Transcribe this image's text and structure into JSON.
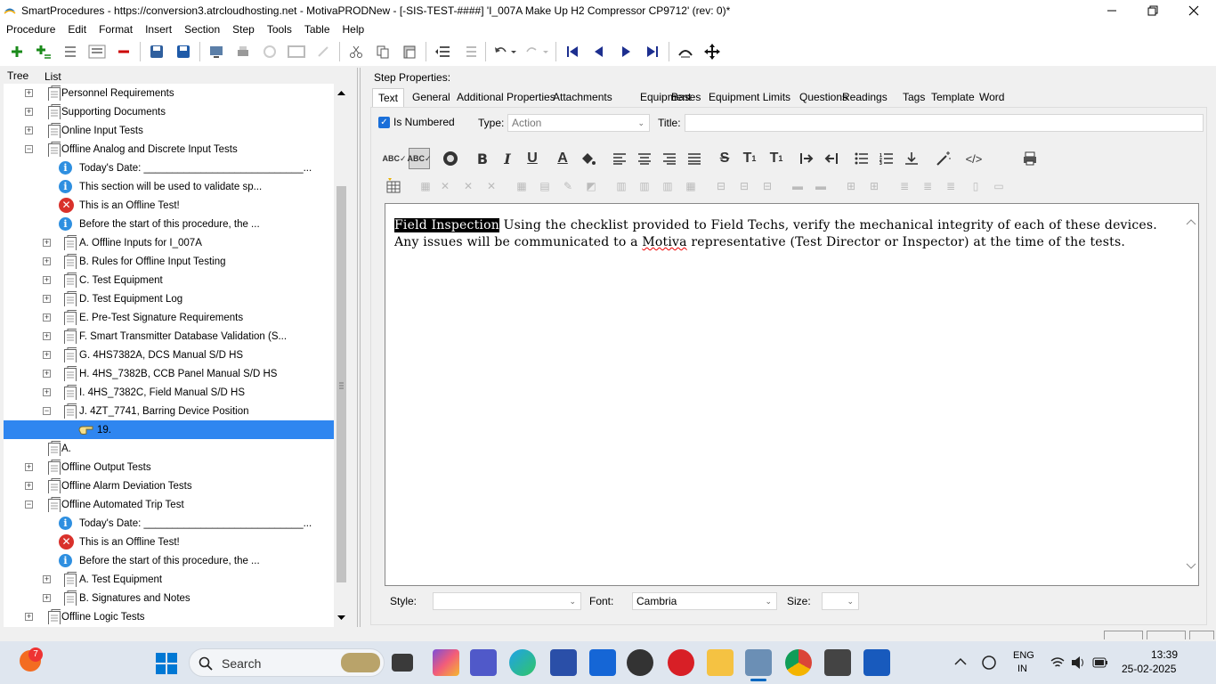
{
  "window": {
    "title": "SmartProcedures - https://conversion3.atrcloudhosting.net - MotivaPRODNew - [-SIS-TEST-####] 'I_007A Make Up H2 Compressor CP9712' (rev: 0)*"
  },
  "menu": [
    "Procedure",
    "Edit",
    "Format",
    "Insert",
    "Section",
    "Step",
    "Tools",
    "Table",
    "Help"
  ],
  "left_tabs": {
    "tree": "Tree",
    "list": "List"
  },
  "tree": [
    {
      "indent": 1,
      "expand": "+",
      "icon": "doc",
      "label": "Personnel Requirements"
    },
    {
      "indent": 1,
      "expand": "+",
      "icon": "doc",
      "label": "Supporting Documents"
    },
    {
      "indent": 1,
      "expand": "+",
      "icon": "doc",
      "label": "Online Input Tests"
    },
    {
      "indent": 1,
      "expand": "−",
      "icon": "doc",
      "label": "Offline Analog and Discrete Input Tests"
    },
    {
      "indent": 2,
      "expand": "",
      "icon": "info",
      "label": "Today's Date: ____________________________..."
    },
    {
      "indent": 2,
      "expand": "",
      "icon": "info",
      "label": "This section will be used to validate sp..."
    },
    {
      "indent": 2,
      "expand": "",
      "icon": "x",
      "label": "This is an Offline Test!"
    },
    {
      "indent": 2,
      "expand": "",
      "icon": "info",
      "label": "Before the start of this procedure, the ..."
    },
    {
      "indent": 2,
      "expand": "+",
      "icon": "doc",
      "label": "A. Offline Inputs for I_007A"
    },
    {
      "indent": 2,
      "expand": "+",
      "icon": "doc",
      "label": "B. Rules for Offline Input Testing"
    },
    {
      "indent": 2,
      "expand": "+",
      "icon": "doc",
      "label": "C. Test Equipment"
    },
    {
      "indent": 2,
      "expand": "+",
      "icon": "doc",
      "label": "D. Test Equipment Log"
    },
    {
      "indent": 2,
      "expand": "+",
      "icon": "doc",
      "label": "E. Pre-Test Signature Requirements"
    },
    {
      "indent": 2,
      "expand": "+",
      "icon": "doc",
      "label": "F. Smart Transmitter Database Validation (S..."
    },
    {
      "indent": 2,
      "expand": "+",
      "icon": "doc",
      "label": "G. 4HS7382A, DCS Manual S/D HS"
    },
    {
      "indent": 2,
      "expand": "+",
      "icon": "doc",
      "label": "H. 4HS_7382B, CCB Panel Manual S/D HS"
    },
    {
      "indent": 2,
      "expand": "+",
      "icon": "doc",
      "label": "I. 4HS_7382C, Field Manual S/D HS"
    },
    {
      "indent": 2,
      "expand": "−",
      "icon": "doc",
      "label": "J. 4ZT_7741, Barring Device Position"
    },
    {
      "indent": 3,
      "expand": "",
      "icon": "hand",
      "label": "19.",
      "selected": true
    },
    {
      "indent": 1,
      "expand": "",
      "icon": "doc",
      "label": "A."
    },
    {
      "indent": 1,
      "expand": "+",
      "icon": "doc",
      "label": "Offline Output Tests"
    },
    {
      "indent": 1,
      "expand": "+",
      "icon": "doc",
      "label": "Offline Alarm Deviation Tests"
    },
    {
      "indent": 1,
      "expand": "−",
      "icon": "doc",
      "label": "Offline Automated Trip Test"
    },
    {
      "indent": 2,
      "expand": "",
      "icon": "info",
      "label": "Today's Date: ____________________________..."
    },
    {
      "indent": 2,
      "expand": "",
      "icon": "x",
      "label": "This is an Offline Test!"
    },
    {
      "indent": 2,
      "expand": "",
      "icon": "info",
      "label": "Before the start of this procedure, the ..."
    },
    {
      "indent": 2,
      "expand": "+",
      "icon": "doc",
      "label": "A. Test Equipment"
    },
    {
      "indent": 2,
      "expand": "+",
      "icon": "doc",
      "label": "B. Signatures and Notes"
    },
    {
      "indent": 1,
      "expand": "+",
      "icon": "doc",
      "label": "Offline Logic Tests"
    }
  ],
  "step_properties": {
    "label": "Step Properties:",
    "tabs": [
      "Text",
      "General",
      "Additional Properties",
      "Attachments",
      "Equipment",
      "Bases",
      "Equipment Limits",
      "Questions",
      "Readings",
      "Tags",
      "Template",
      "Word"
    ],
    "active_tab": "Text",
    "is_numbered_label": "Is Numbered",
    "is_numbered": true,
    "type_label": "Type:",
    "type_value": "Action",
    "title_label": "Title:",
    "title_value": ""
  },
  "editor": {
    "highlight": "Field Inspection",
    "text_a": " Using the checklist provided to Field Techs, verify the mechanical integrity of each of these devices. Any issues will be communicated to a ",
    "misspelled": "Motiva",
    "text_b": " representative (Test Director or Inspector) at the time of the tests."
  },
  "format_bar": {
    "style_label": "Style:",
    "style_value": "",
    "font_label": "Font:",
    "font_value": "Cambria",
    "size_label": "Size:",
    "size_value": ""
  },
  "taskbar": {
    "search": "Search",
    "badge": "7",
    "lang1": "ENG",
    "lang2": "IN",
    "time": "13:39",
    "date": "25-02-2025"
  }
}
